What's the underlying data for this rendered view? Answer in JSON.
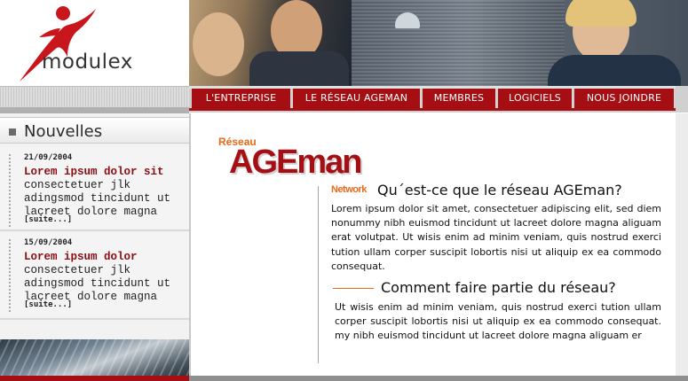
{
  "brand": {
    "logo_text": "modulex",
    "accent": "#a50f14",
    "orange": "#e86a1a"
  },
  "nav": {
    "items": [
      {
        "label": "L'ENTREPRISE"
      },
      {
        "label": "LE RÉSEAU AGEMAN"
      },
      {
        "label": "MEMBRES"
      },
      {
        "label": "LOGICIELS"
      },
      {
        "label": "NOUS JOINDRE"
      }
    ]
  },
  "sidebar": {
    "title": "Nouvelles",
    "news": [
      {
        "date": "21/09/2004",
        "headline": "Lorem ipsum dolor sit",
        "body": "consectetuer jlk adingsmod tincidunt ut lacreet dolore magna",
        "more": "[suite...]"
      },
      {
        "date": "15/09/2004",
        "headline": "Lorem ipsum dolor",
        "body": "consectetuer jlk adingsmod tincidunt ut lacreet dolore magna",
        "more": "[suite...]"
      }
    ]
  },
  "main": {
    "logo": {
      "reseau": "Réseau",
      "name": "AGEman",
      "network": "Network"
    },
    "section1": {
      "heading": "Qu´est-ce que le réseau AGEman?",
      "body": "Lorem ipsum dolor sit amet, consectetuer adipiscing elit, sed diem nonummy nibh euismod tincidunt ut lacreet dolore magna aliguam erat volutpat. Ut wisis enim ad minim veniam, quis nostrud exerci tution ullam corper suscipit lobortis nisi ut aliquip ex ea commodo consequat."
    },
    "section2": {
      "heading": "Comment faire partie du réseau?",
      "body": "Ut wisis enim ad minim veniam, quis nostrud exerci tution ullam corper suscipit lobortis nisi ut aliquip ex ea commodo consequat. my nibh euismod tincidunt ut lacreet dolore magna aliguam er"
    }
  }
}
